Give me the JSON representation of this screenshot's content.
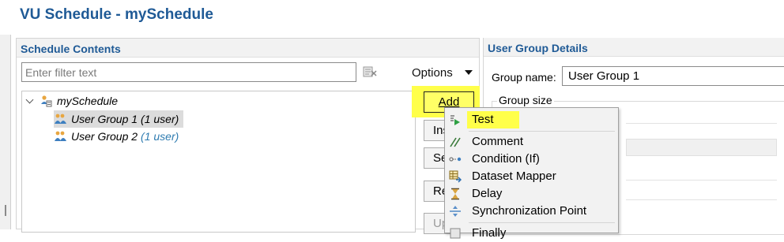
{
  "title": "VU Schedule - mySchedule",
  "schedule_contents": {
    "header": "Schedule Contents",
    "filter_placeholder": "Enter filter text",
    "options_label": "Options",
    "tree": {
      "root": "mySchedule",
      "groups": [
        {
          "name": "User Group 1",
          "count": "(1 user)"
        },
        {
          "name": "User Group 2",
          "count": "(1 user)"
        }
      ]
    },
    "buttons": {
      "add": "Add",
      "insert": "Insert...",
      "set": "Set User Load...",
      "remove": "Remove",
      "up": "Up"
    }
  },
  "user_group_details": {
    "header": "User Group Details",
    "group_name_label": "Group name:",
    "group_name_value": "User Group 1",
    "group_size_label": "Group size"
  },
  "add_menu": {
    "items": [
      {
        "label": "Test",
        "icon": "test-icon"
      },
      {
        "label": "Comment",
        "icon": "comment-icon"
      },
      {
        "label": "Condition (If)",
        "icon": "condition-icon"
      },
      {
        "label": "Dataset Mapper",
        "icon": "dataset-mapper-icon"
      },
      {
        "label": "Delay",
        "icon": "delay-icon"
      },
      {
        "label": "Synchronization Point",
        "icon": "sync-point-icon"
      },
      {
        "label": "Finally",
        "icon": "finally-icon"
      }
    ]
  },
  "colors": {
    "title": "#1f5a96",
    "highlight": "#ffff4a",
    "count_blue": "#2e7bb0"
  }
}
